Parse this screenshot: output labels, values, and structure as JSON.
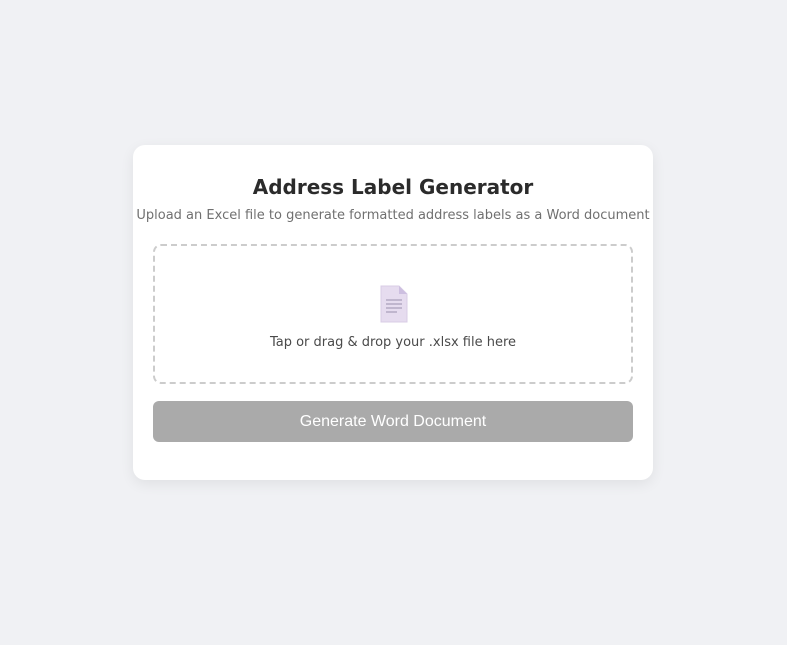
{
  "app": {
    "title": "Address Label Generator",
    "subtitle": "Upload an Excel file to generate formatted address labels as a Word document"
  },
  "dropzone": {
    "icon": "document-icon",
    "prompt": "Tap or drag & drop your .xlsx file here"
  },
  "actions": {
    "generate_label": "Generate Word Document",
    "generate_enabled": false
  },
  "colors": {
    "background": "#f0f1f4",
    "card": "#ffffff",
    "button_disabled": "#aaaaaa",
    "dropzone_border": "#cccccc",
    "icon_fill": "#e6dcef"
  }
}
